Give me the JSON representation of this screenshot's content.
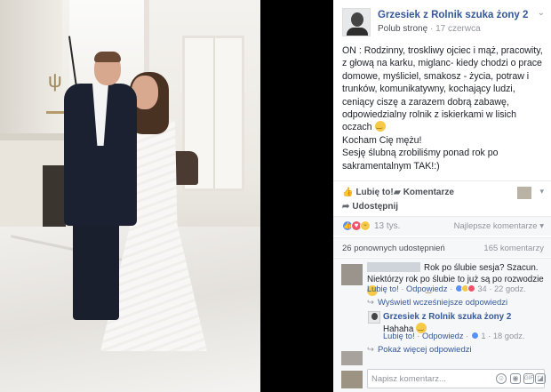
{
  "post": {
    "page_name": "Grzesiek z Rolnik szuka żony 2",
    "like_page_link": "Polub stronę",
    "meta_sep": "·",
    "date": "17 czerwca",
    "text_para1": "ON : Rodzinny, troskliwy ojciec i mąż, pracowity, z głową na karku, miglanc- kiedy chodzi o prace domowe, myśliciel, smakosz - życia, potraw i trunków, komunikatywny, kochający ludzi, ceniący ciszę a zarazem dobrą zabawę, odpowiedzialny rolnik z iskierkami w lisich oczach",
    "text_para2": "Kocham Cię mężu!",
    "text_para3": "Sesję ślubną zrobiliśmy ponad rok po sakramentalnym TAK!:)"
  },
  "actions": {
    "like": "Lubię to!",
    "comment": "Komentarze",
    "share": "Udostępnij"
  },
  "reactions": {
    "count": "13 tys.",
    "sort": "Najlepsze komentarze"
  },
  "counts": {
    "shares": "26 ponownych udostępnień",
    "comments": "165 komentarzy"
  },
  "comments": [
    {
      "text": "Rok po ślubie sesja? Szacun. Niektórzy rok po ślubie to już są po rozwodzie",
      "like": "Lubię to!",
      "reply": "Odpowiedz",
      "sep": "·",
      "reactions": "34",
      "time": "22 godz."
    }
  ],
  "previous_replies": "Wyświetl wcześniejsze odpowiedzi",
  "reply": {
    "author": "Grzesiek z Rolnik szuka żony 2",
    "text": "Hahaha",
    "like": "Lubię to!",
    "reply_link": "Odpowiedz",
    "sep": "·",
    "reactions": "1",
    "time": "18 godz."
  },
  "more_replies": "Pokaż więcej odpowiedzi",
  "comment_input": {
    "placeholder": "Napisz komentarz..."
  },
  "icons": {
    "reply_arrow": "reply-arrow-icon",
    "thumbs_up": "thumbs-up-icon",
    "comment": "comment-bubble-icon",
    "share": "share-arrow-icon"
  },
  "colors": {
    "link": "#365899",
    "text": "#1d2129",
    "muted": "#90949c",
    "like_blue": "#5890ff",
    "love_red": "#f25268"
  }
}
